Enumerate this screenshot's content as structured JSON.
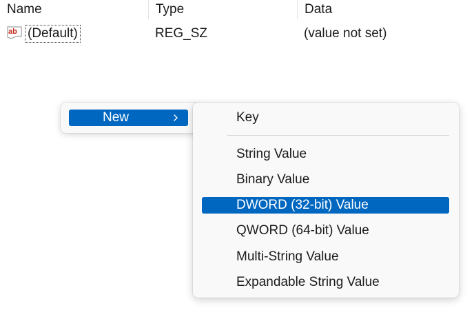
{
  "list": {
    "headers": {
      "name": "Name",
      "type": "Type",
      "data": "Data"
    },
    "rows": [
      {
        "icon": "string-value-ab-icon",
        "name": "(Default)",
        "type": "REG_SZ",
        "data": "(value not set)"
      }
    ]
  },
  "context_menu": {
    "new_label": "New",
    "submenu_icon": "chevron-right-icon"
  },
  "submenu": {
    "items": [
      {
        "label": "Key",
        "highlighted": false
      },
      {
        "label": "String Value",
        "highlighted": false
      },
      {
        "label": "Binary Value",
        "highlighted": false
      },
      {
        "label": "DWORD (32-bit) Value",
        "highlighted": true
      },
      {
        "label": "QWORD (64-bit) Value",
        "highlighted": false
      },
      {
        "label": "Multi-String Value",
        "highlighted": false
      },
      {
        "label": "Expandable String Value",
        "highlighted": false
      }
    ]
  },
  "colors": {
    "highlight": "#0067c0",
    "menu_background": "#f9f9f9",
    "icon_red": "#c42b1c"
  }
}
